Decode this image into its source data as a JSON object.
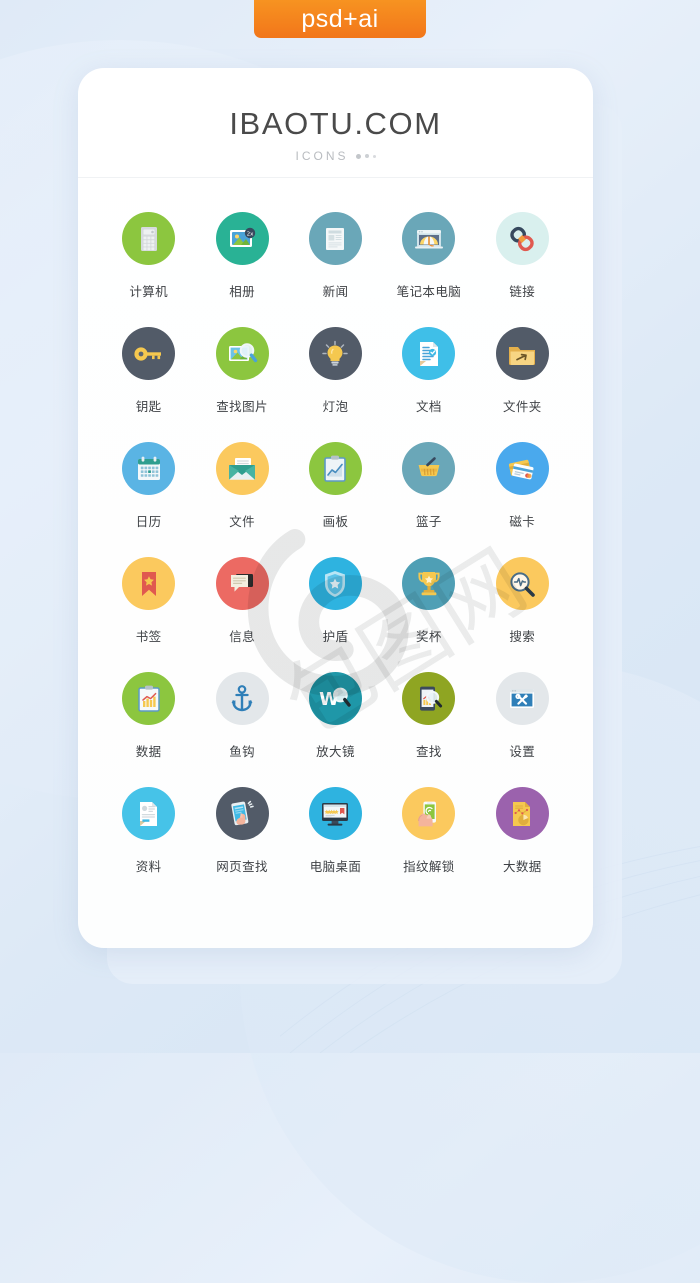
{
  "badge": {
    "label": "psd+ai"
  },
  "header": {
    "title": "IBAOTU.COM",
    "subtitle": "ICONS"
  },
  "watermark": {
    "text": "包图网"
  },
  "colors": {
    "badge_orange": "#f2761a",
    "bg_blue": "#dfeaf7",
    "card_white": "#ffffff",
    "label_gray": "#3f4246",
    "green": "#8cc63f",
    "teal": "#29b295",
    "steel_blue": "#6aa7b8",
    "slate": "#525b68",
    "sky": "#3fbfe8",
    "amber": "#fbc95e",
    "red": "#ec6a63",
    "purple": "#9b62ad",
    "light_gray": "#dfe3e6",
    "pale_teal": "#d9f0ee",
    "olive": "#8fa522",
    "dark_teal": "#1f97a8"
  },
  "icons": [
    {
      "label": "计算机",
      "name": "calculator-icon",
      "circle": "#8cc63f"
    },
    {
      "label": "相册",
      "name": "photo-album-icon",
      "circle": "#29b295"
    },
    {
      "label": "新闻",
      "name": "news-icon",
      "circle": "#6aa7b8"
    },
    {
      "label": "笔记本电脑",
      "name": "laptop-icon",
      "circle": "#6aa7b8"
    },
    {
      "label": "链接",
      "name": "link-icon",
      "circle": "#d9f0ee"
    },
    {
      "label": "钥匙",
      "name": "key-icon",
      "circle": "#525b68"
    },
    {
      "label": "查找图片",
      "name": "image-search-icon",
      "circle": "#8cc63f"
    },
    {
      "label": "灯泡",
      "name": "lightbulb-icon",
      "circle": "#525b68"
    },
    {
      "label": "文档",
      "name": "document-icon",
      "circle": "#3fbfe8"
    },
    {
      "label": "文件夹",
      "name": "folder-icon",
      "circle": "#525b68"
    },
    {
      "label": "日历",
      "name": "calendar-icon",
      "circle": "#5ab4e4"
    },
    {
      "label": "文件",
      "name": "envelope-icon",
      "circle": "#fbc95e"
    },
    {
      "label": "画板",
      "name": "drawing-board-icon",
      "circle": "#8cc63f"
    },
    {
      "label": "篮子",
      "name": "basket-icon",
      "circle": "#6aa7b8"
    },
    {
      "label": "磁卡",
      "name": "magnetic-card-icon",
      "circle": "#4aa9ed"
    },
    {
      "label": "书签",
      "name": "bookmark-icon",
      "circle": "#fbc95e"
    },
    {
      "label": "信息",
      "name": "message-icon",
      "circle": "#ec6a63"
    },
    {
      "label": "护盾",
      "name": "shield-icon",
      "circle": "#2eb3e0"
    },
    {
      "label": "奖杯",
      "name": "trophy-icon",
      "circle": "#4f9fb5"
    },
    {
      "label": "搜索",
      "name": "search-icon",
      "circle": "#fbc95e"
    },
    {
      "label": "数据",
      "name": "data-chart-icon",
      "circle": "#8cc63f"
    },
    {
      "label": "鱼钩",
      "name": "anchor-icon",
      "circle": "#e3e7ea"
    },
    {
      "label": "放大镜",
      "name": "magnifier-w-icon",
      "circle": "#1f97a8"
    },
    {
      "label": "查找",
      "name": "mobile-search-icon",
      "circle": "#8fa522"
    },
    {
      "label": "设置",
      "name": "settings-icon",
      "circle": "#e3e7ea"
    },
    {
      "label": "资料",
      "name": "profile-doc-icon",
      "circle": "#46c3e8"
    },
    {
      "label": "网页查找",
      "name": "web-search-icon",
      "circle": "#525b68"
    },
    {
      "label": "电脑桌面",
      "name": "desktop-icon",
      "circle": "#2eb3e0"
    },
    {
      "label": "指纹解锁",
      "name": "fingerprint-unlock-icon",
      "circle": "#fbc95e"
    },
    {
      "label": "大数据",
      "name": "big-data-icon",
      "circle": "#9b62ad"
    }
  ]
}
